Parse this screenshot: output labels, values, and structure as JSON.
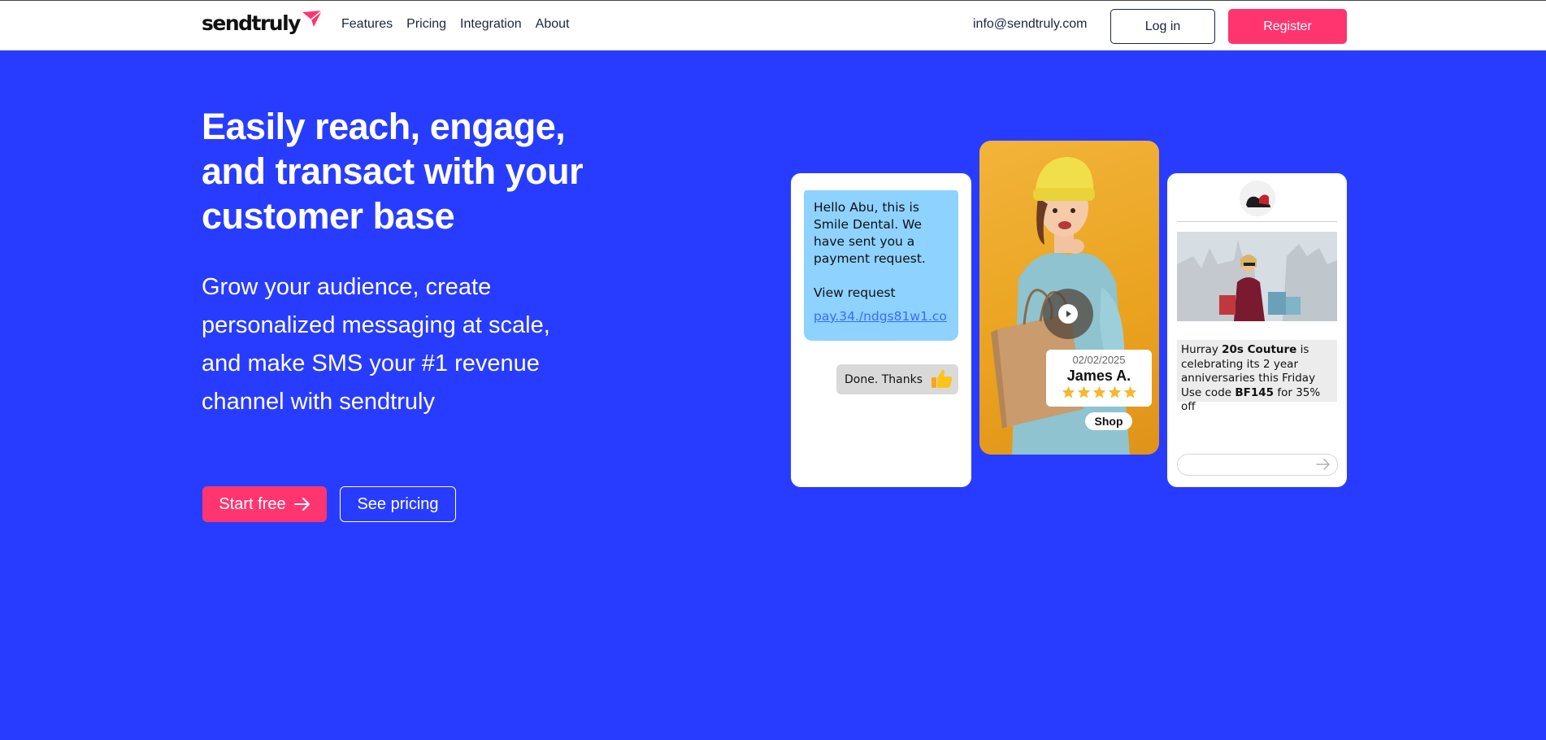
{
  "nav": {
    "logo_text": "sendtruly",
    "links": [
      "Features",
      "Pricing",
      "Integration",
      "About"
    ],
    "email": "info@sendtruly.com",
    "login_label": "Log in",
    "register_label": "Register"
  },
  "hero": {
    "title": "Easily reach, engage, and transact with your customer base",
    "subtitle": "Grow your audience, create personalized messaging at scale, and make SMS your #1 revenue channel with sendtruly",
    "start_label": "Start free",
    "pricing_label": "See pricing"
  },
  "sms_card": {
    "message": "Hello Abu, this is Smile Dental. We have sent you a payment request.",
    "action": "View request",
    "link": "pay.34./ndgs81w1.co",
    "reply": "Done. Thanks"
  },
  "video_card": {
    "date": "02/02/2025",
    "name": "James A.",
    "rating": 5,
    "shop_label": "Shop"
  },
  "promo_card": {
    "text_1": "Hurray ",
    "brand": "20s Couture",
    "text_2": " is celebrating its 2 year anniversaries this Friday Use code ",
    "code": "BF145",
    "text_3": " for 35% off"
  },
  "colors": {
    "background": "#283cff",
    "accent": "#ff3570",
    "sms_bubble": "#8ed2ff"
  }
}
